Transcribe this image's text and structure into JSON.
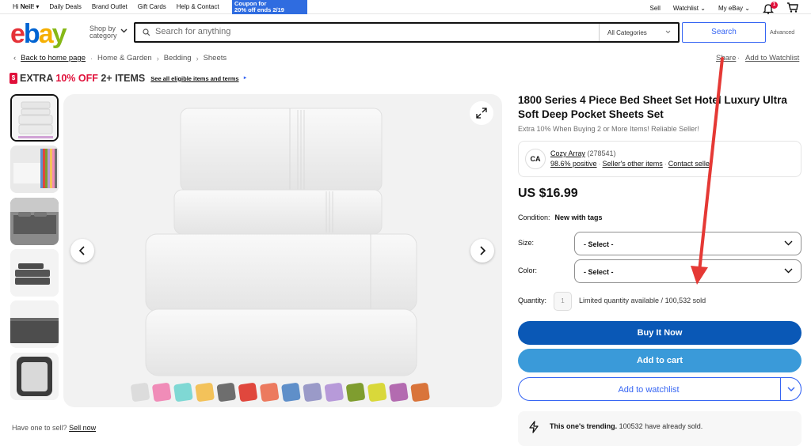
{
  "topbar": {
    "greeting_prefix": "Hi ",
    "greeting_name": "Neil!",
    "links": [
      "Daily Deals",
      "Brand Outlet",
      "Gift Cards",
      "Help & Contact"
    ],
    "coupon_line1": "Coupon for",
    "coupon_line2": "20% off ends 2/19",
    "sell": "Sell",
    "watchlist": "Watchlist",
    "myebay": "My eBay",
    "notif_count": "1"
  },
  "header": {
    "logo": [
      "e",
      "b",
      "a",
      "y"
    ],
    "shop_by_line1": "Shop by",
    "shop_by_line2": "category",
    "search_placeholder": "Search for anything",
    "category": "All Categories",
    "search_button": "Search",
    "advanced": "Advanced"
  },
  "breadcrumb": {
    "back": "Back to home page",
    "items": [
      "Home & Garden",
      "Bedding",
      "Sheets"
    ],
    "share": "Share",
    "add_watchlist": "Add to Watchlist"
  },
  "promo": {
    "tag": "$",
    "text_a": "EXTRA ",
    "text_b": "10% OFF",
    "text_c": " 2+ ITEMS",
    "link": "See all eligible items and terms",
    "arrow": "►"
  },
  "sell_one": {
    "text": "Have one to sell?",
    "link": "Sell now"
  },
  "product": {
    "title": "1800 Series 4 Piece Bed Sheet Set Hotel Luxury Ultra Soft Deep Pocket Sheets Set",
    "subtitle": "Extra 10% When Buying 2 or More Items! Reliable Seller!",
    "seller_logo": "CA",
    "seller_name": "Cozy Array",
    "seller_count": "(278541)",
    "seller_positive": "98.6% positive",
    "seller_other": "Seller's other items",
    "seller_contact": "Contact seller",
    "price": "US $16.99",
    "condition_label": "Condition:",
    "condition_value": "New with tags",
    "size_label": "Size:",
    "size_value": "- Select -",
    "color_label": "Color:",
    "color_value": "- Select -",
    "quantity_label": "Quantity:",
    "quantity_value": "1",
    "quantity_info": "Limited quantity available / 100,532 sold",
    "buy_now": "Buy It Now",
    "add_cart": "Add to cart",
    "add_watchlist": "Add to watchlist",
    "trend_bold": "This one's trending.",
    "trend_text": " 100532 have already sold."
  },
  "swatches": [
    "#dcdcdc",
    "#f08cb8",
    "#7fd8d4",
    "#f3c25a",
    "#6e6e6e",
    "#e0473d",
    "#ec7a5f",
    "#5f8fc9",
    "#9a9ac8",
    "#b79ad9",
    "#7f9d2f",
    "#d9d83a",
    "#b36bb0",
    "#d9743a"
  ],
  "annotation": {
    "arrow_color": "#e53935"
  }
}
